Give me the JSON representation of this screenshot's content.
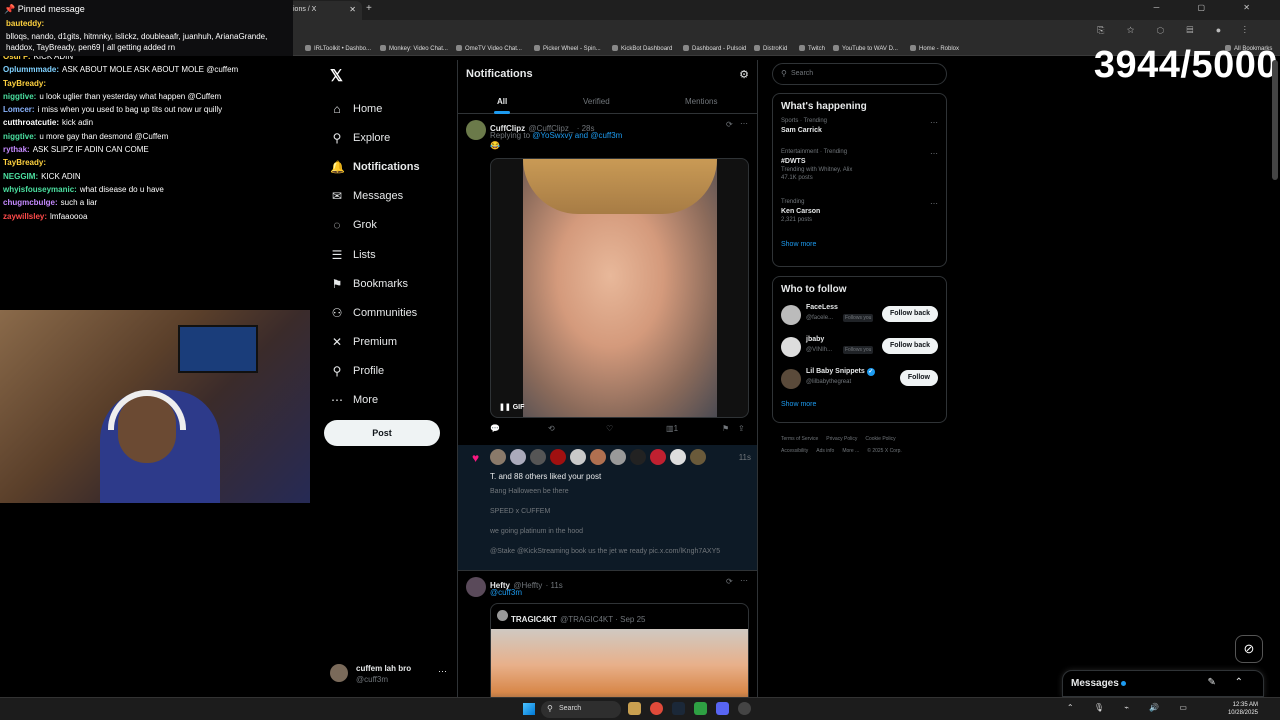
{
  "browser": {
    "tab_title": "ions / X",
    "bookmarks": [
      "IRLToolkit • Dashbo...",
      "Monkey: Video Chat...",
      "OmeTV Video Chat...",
      "Picker Wheel - Spin...",
      "KickBot Dashboard",
      "Dashboard - Pulsoid",
      "DistroKid",
      "Twitch",
      "YouTube to WAV D...",
      "Home - Roblox",
      "All Bookmarks"
    ]
  },
  "overlay": {
    "pinned_title": "Pinned message",
    "pinned_user": "bauteddy:",
    "pinned_text": "blloqs, nando, d1gits, hitmnky, islickz, doubleaafr, juanhuh, ArianaGrande, haddox, TayBready, pen69 | all getting added rn",
    "counter": "3944/5000",
    "chat": [
      {
        "user": "Osui F:",
        "text": "KICK ADIN",
        "color": "#ffd23f"
      },
      {
        "user": "Oplummmade:",
        "text": "ASK ABOUT MOLE ASK ABOUT MOLE @cuffem",
        "color": "#7fd1ff"
      },
      {
        "user": "TayBready:",
        "text": "",
        "color": "#ffd23f"
      },
      {
        "user": "niggtive:",
        "text": "u look uglier than yesterday what happen @Cuffem",
        "color": "#4be0a0"
      },
      {
        "user": "Lomcer:",
        "text": "i miss when you used to bag up tits out now ur quilly",
        "color": "#8ab4ff"
      },
      {
        "user": "cutthroatcutie:",
        "text": "kick adin",
        "color": "#ffffff"
      },
      {
        "user": "niggtive:",
        "text": "u more gay than desmond @Cuffem",
        "color": "#4be0a0"
      },
      {
        "user": "rythak:",
        "text": "ASK SLIPZ IF ADIN CAN COME",
        "color": "#c58aff"
      },
      {
        "user": "TayBready:",
        "text": "",
        "color": "#ffd23f"
      },
      {
        "user": "NEGGIM:",
        "text": "KICK ADIN",
        "color": "#4be0a0"
      },
      {
        "user": "whyisfouseymanic:",
        "text": "what disease do u have",
        "color": "#4be0a0"
      },
      {
        "user": "chugmcbulge:",
        "text": "such a liar",
        "color": "#c58aff"
      },
      {
        "user": "zaywillsley:",
        "text": "lmfaaoooa",
        "color": "#ff4a4a"
      }
    ]
  },
  "nav": {
    "items": [
      {
        "label": "Home",
        "icon": "home-icon",
        "glyph": "⌂"
      },
      {
        "label": "Explore",
        "icon": "search-icon",
        "glyph": "⚲"
      },
      {
        "label": "Notifications",
        "icon": "bell-icon",
        "glyph": "🔔"
      },
      {
        "label": "Messages",
        "icon": "envelope-icon",
        "glyph": "✉"
      },
      {
        "label": "Grok",
        "icon": "grok-icon",
        "glyph": "◌"
      },
      {
        "label": "Lists",
        "icon": "list-icon",
        "glyph": "☰"
      },
      {
        "label": "Bookmarks",
        "icon": "bookmark-icon",
        "glyph": "⚑"
      },
      {
        "label": "Communities",
        "icon": "communities-icon",
        "glyph": "⚇"
      },
      {
        "label": "Premium",
        "icon": "x-premium-icon",
        "glyph": "✕"
      },
      {
        "label": "Profile",
        "icon": "person-icon",
        "glyph": "⚲"
      },
      {
        "label": "More",
        "icon": "more-circle-icon",
        "glyph": "⋯"
      }
    ],
    "post_label": "Post",
    "account_name": "cuffem lah bro",
    "account_handle": "@cuff3m"
  },
  "notifications": {
    "title": "Notifications",
    "tabs": [
      "All",
      "Verified",
      "Mentions"
    ],
    "tweet1": {
      "name": "CuffClipz",
      "handle": "@CuffClipz_",
      "time": "· 28s",
      "replying_prefix": "Replying to",
      "replying_to": "@YoSwxvy and @cuff3m",
      "emoji": "😂",
      "gif_label": "GIF",
      "views": "1"
    },
    "liked": {
      "time": "11s",
      "title": "T. and 88 others liked your post",
      "lines": [
        "Bang Halloween be there",
        "SPEED x CUFFEM",
        "we going platinum in the hood",
        "@Stake @KickStreaming book us the jet we ready pic.x.com/lKngh7AXY5"
      ]
    },
    "tweet2": {
      "name": "Hefty",
      "handle": "@Heffty",
      "time": "· 11s",
      "mention": "@cuff3m",
      "quote_name": "TRAGIC4KT",
      "quote_handle": "@TRAGIC4KT · Sep 25"
    }
  },
  "sidebar": {
    "search_placeholder": "Search",
    "happening_title": "What's happening",
    "trends": [
      {
        "category": "Sports · Trending",
        "name": "Sam Carrick",
        "sub": ""
      },
      {
        "category": "Entertainment · Trending",
        "name": "#DWTS",
        "sub": "Trending with Whitney, Alix",
        "sub2": "47.1K posts"
      },
      {
        "category": "Trending",
        "name": "Ken Carson",
        "sub": "2,321 posts"
      }
    ],
    "show_more": "Show more",
    "follow_title": "Who to follow",
    "follows": [
      {
        "name": "FaceLess",
        "handle": "@facele...",
        "tag": "Follows you",
        "button": "Follow back"
      },
      {
        "name": "jbaby",
        "handle": "@VINIh...",
        "tag": "Follows you",
        "button": "Follow back"
      },
      {
        "name": "Lil Baby Snippets",
        "handle": "@lilbabythegreat",
        "tag": "",
        "button": "Follow"
      }
    ],
    "footer": [
      "Terms of Service",
      "Privacy Policy",
      "Cookie Policy",
      "Accessibility",
      "Ads info",
      "More ...",
      "© 2025 X Corp."
    ]
  },
  "messages_dock": {
    "title": "Messages"
  },
  "taskbar": {
    "search_placeholder": "Search",
    "time": "12:35 AM",
    "date": "10/28/2025"
  },
  "colors": {
    "accent": "#1d9bf0",
    "like": "#f91880",
    "background": "#000000"
  }
}
